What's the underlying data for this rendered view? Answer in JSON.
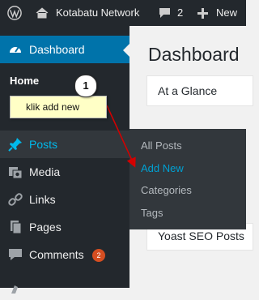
{
  "adminbar": {
    "site_name": "Kotabatu Network",
    "comments_count": "2",
    "new_label": "New"
  },
  "sidebar": {
    "dashboard": "Dashboard",
    "home": "Home",
    "posts": "Posts",
    "media": "Media",
    "links": "Links",
    "pages": "Pages",
    "comments": "Comments",
    "comments_badge": "2"
  },
  "posts_submenu": {
    "all_posts": "All Posts",
    "add_new": "Add New",
    "categories": "Categories",
    "tags": "Tags"
  },
  "main": {
    "page_title": "Dashboard",
    "at_a_glance": "At a Glance",
    "yoast_box": "Yoast SEO Posts"
  },
  "annotation": {
    "step_number": "1",
    "callout_text": "klik add new"
  },
  "colors": {
    "adminbar_bg": "#23282d",
    "sidebar_bg": "#23282d",
    "active_blue": "#0073aa",
    "link_blue": "#00a0d2",
    "badge_orange": "#d54e21",
    "callout_yellow": "#ffffc6",
    "arrow_red": "#d40000"
  },
  "icons": [
    "wordpress-logo",
    "home-icon",
    "comment-bubble",
    "plus",
    "dashboard-gauge",
    "pushpin",
    "media-camera",
    "link-chain",
    "pages-document",
    "comment-speech"
  ]
}
